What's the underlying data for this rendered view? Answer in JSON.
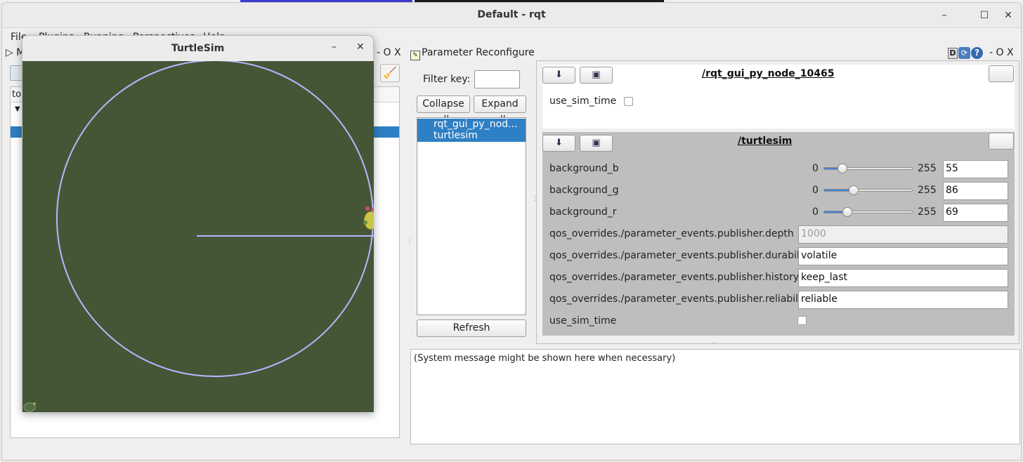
{
  "window": {
    "title": "Default - rqt",
    "minimize": "–",
    "maximize": "☐",
    "close": "✕"
  },
  "menubar": [
    "File",
    "Plugins",
    "Running",
    "Perspectives",
    "Help"
  ],
  "left_dock": {
    "title": "M",
    "controls": "- O X",
    "tree_header": "to"
  },
  "turtlesim": {
    "title": "TurtleSim",
    "minimize": "–",
    "close": "✕",
    "background": "#455636",
    "trail_color": "#b3b8ff"
  },
  "param_reconfigure": {
    "title": "Parameter Reconfigure",
    "controls": "- O X",
    "help_icon_d": "D",
    "filter_label": "Filter key:",
    "filter_value": "",
    "collapse_all": "Collapse all",
    "expand_all": "Expand all",
    "nodes": [
      "rqt_gui_py_nod...",
      "turtlesim"
    ],
    "refresh": "Refresh",
    "selected_color": "#2f7fc4",
    "panels": [
      {
        "name": "/rqt_gui_py_node_10465",
        "params": [
          {
            "label": "use_sim_time",
            "checked": false
          }
        ]
      },
      {
        "name": "/turtlesim",
        "sliders": [
          {
            "label": "background_b",
            "min": "0",
            "max": "255",
            "value": "55",
            "num": 55
          },
          {
            "label": "background_g",
            "min": "0",
            "max": "255",
            "value": "86",
            "num": 86
          },
          {
            "label": "background_r",
            "min": "0",
            "max": "255",
            "value": "69",
            "num": 69
          }
        ],
        "text_params": [
          {
            "label": "qos_overrides./parameter_events.publisher.depth",
            "value": "1000",
            "disabled": true
          },
          {
            "label": "qos_overrides./parameter_events.publisher.durabil",
            "value": "volatile"
          },
          {
            "label": "qos_overrides./parameter_events.publisher.history",
            "value": "keep_last"
          },
          {
            "label": "qos_overrides./parameter_events.publisher.reliabili",
            "value": "reliable"
          }
        ],
        "use_sim_time": {
          "label": "use_sim_time",
          "checked": false
        }
      }
    ],
    "system_message": "(System message might be shown here when necessary)"
  }
}
